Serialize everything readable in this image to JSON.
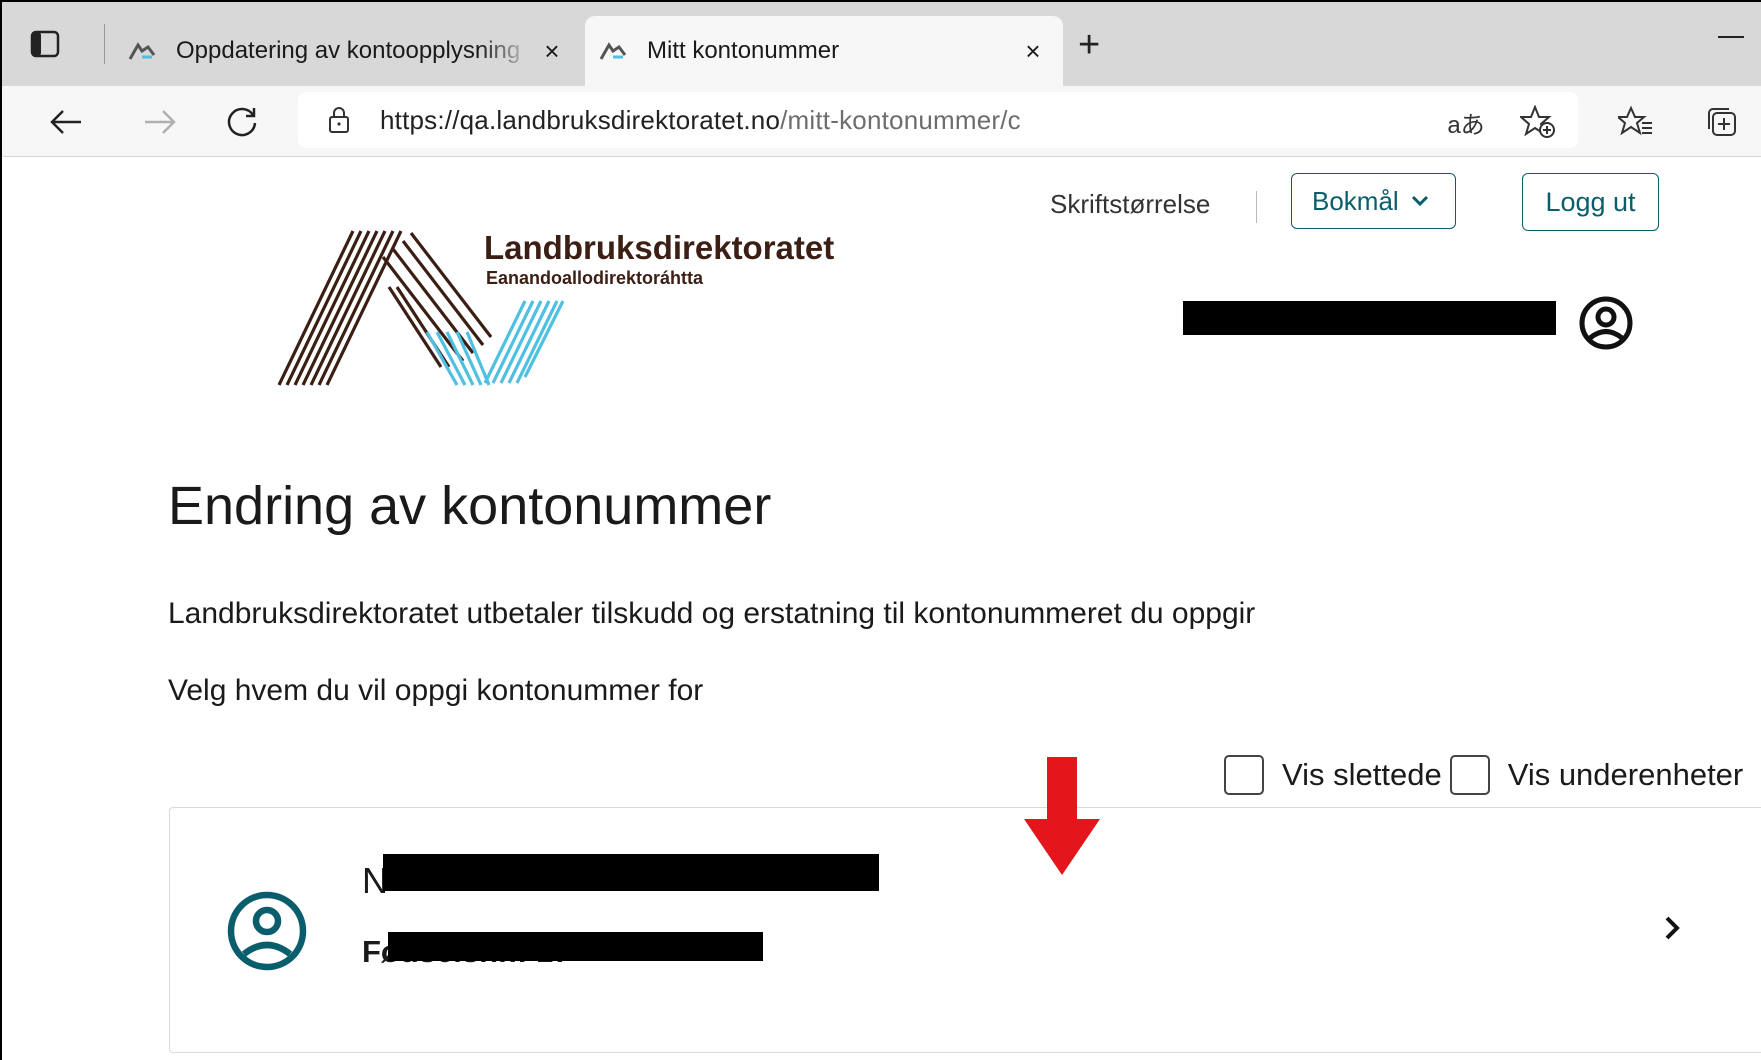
{
  "browser": {
    "tabs": [
      {
        "title": "Oppdatering av kontoopplysning",
        "close": "×"
      },
      {
        "title": "Mitt kontonummer",
        "close": "×"
      }
    ],
    "new_tab": "+",
    "url_host": "https://qa.landbruksdirektoratet.no",
    "url_path": "/mitt-kontonummer/c",
    "read_aloud": "aあ"
  },
  "header": {
    "font_size_label": "Skriftstørrelse",
    "language": "Bokmål",
    "logout_label": "Logg ut"
  },
  "logo": {
    "name": "Landbruksdirektoratet",
    "subtitle": "Eanandoallodirektoráhtta"
  },
  "main": {
    "heading": "Endring av kontonummer",
    "intro": "Landbruksdirektoratet utbetaler tilskudd og erstatning til kontonummeret du oppgir",
    "choose": "Velg hvem du vil oppgi kontonummer for",
    "filters": {
      "show_deleted": "Vis slettede",
      "show_subunits": "Vis underenheter"
    },
    "card": {
      "name_prefix": "N",
      "id_label": "Fødselsnr.: 17"
    }
  },
  "colors": {
    "accent": "#0a5e6b",
    "logo_brown": "#3b1e14",
    "logo_blue": "#4fc0e0",
    "arrow_red": "#e3161c"
  }
}
